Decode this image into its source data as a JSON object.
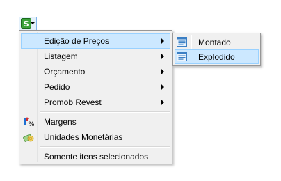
{
  "toolbar": {
    "button_icon": "money-icon",
    "accent_color": "#2a8a2a"
  },
  "menu": {
    "items": [
      {
        "label": "Edição de Preços",
        "has_submenu": true,
        "highlighted": true
      },
      {
        "label": "Listagem",
        "has_submenu": true
      },
      {
        "label": "Orçamento",
        "has_submenu": true
      },
      {
        "label": "Pedido",
        "has_submenu": true
      },
      {
        "label": "Promob Revest",
        "has_submenu": true
      },
      {
        "label": "Margens",
        "icon": "percent-margin-icon"
      },
      {
        "label": "Unidades Monetárias",
        "icon": "currency-icon"
      },
      {
        "label": "Somente itens selecionados"
      }
    ]
  },
  "submenu": {
    "items": [
      {
        "label": "Montado",
        "icon": "price-list-icon"
      },
      {
        "label": "Explodido",
        "icon": "price-list-icon",
        "highlighted": true
      }
    ]
  },
  "colors": {
    "highlight_bg": "#cce8ff",
    "highlight_border": "#99d1ff",
    "menu_bg": "#f0f0f0"
  }
}
